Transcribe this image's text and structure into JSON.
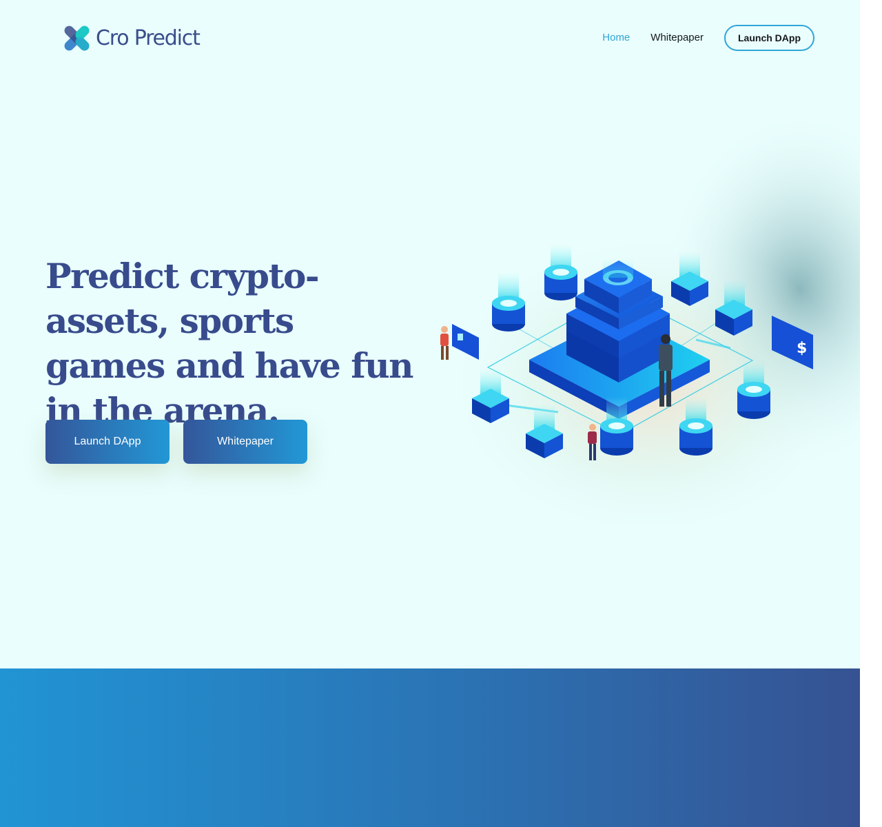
{
  "brand": {
    "name": "Cro Predict",
    "logo_colors": {
      "teal": "#1dc9c4",
      "blue": "#2f7dc8",
      "navy": "#3a4d8a"
    }
  },
  "nav": {
    "links": [
      {
        "label": "Home",
        "active": true
      },
      {
        "label": "Whitepaper",
        "active": false
      }
    ],
    "cta_label": "Launch DApp"
  },
  "hero": {
    "title": "Predict crypto-assets, sports games and have fun in the arena.",
    "buttons": [
      {
        "label": "Launch DApp"
      },
      {
        "label": "Whitepaper"
      }
    ],
    "illustration": "isometric-blockchain-server-illustration"
  },
  "colors": {
    "hero_background": "#e9fefd",
    "title": "#384b8c",
    "accent": "#2fa5d8",
    "gradient_start": "#2194d4",
    "gradient_end": "#365292"
  }
}
